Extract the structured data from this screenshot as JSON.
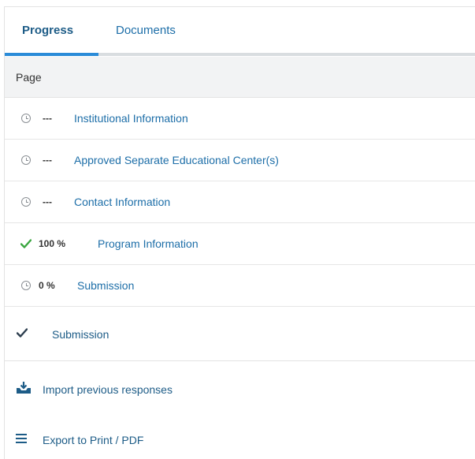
{
  "tabs": {
    "progress": "Progress",
    "documents": "Documents"
  },
  "table": {
    "header": "Page",
    "rows": [
      {
        "status": "pending",
        "percent": "---",
        "label": "Institutional Information"
      },
      {
        "status": "pending",
        "percent": "---",
        "label": "Approved Separate Educational Center(s)"
      },
      {
        "status": "pending",
        "percent": "---",
        "label": "Contact Information"
      },
      {
        "status": "complete",
        "percent": "100 %",
        "label": "Program Information"
      },
      {
        "status": "pending",
        "percent": "0 %",
        "label": "Submission"
      }
    ]
  },
  "submission": {
    "label": "Submission"
  },
  "actions": {
    "import": "Import previous responses",
    "export": "Export to Print / PDF"
  },
  "colors": {
    "accent": "#2a8bd8",
    "link": "#1d6ea8",
    "check_green": "#3aa640"
  }
}
